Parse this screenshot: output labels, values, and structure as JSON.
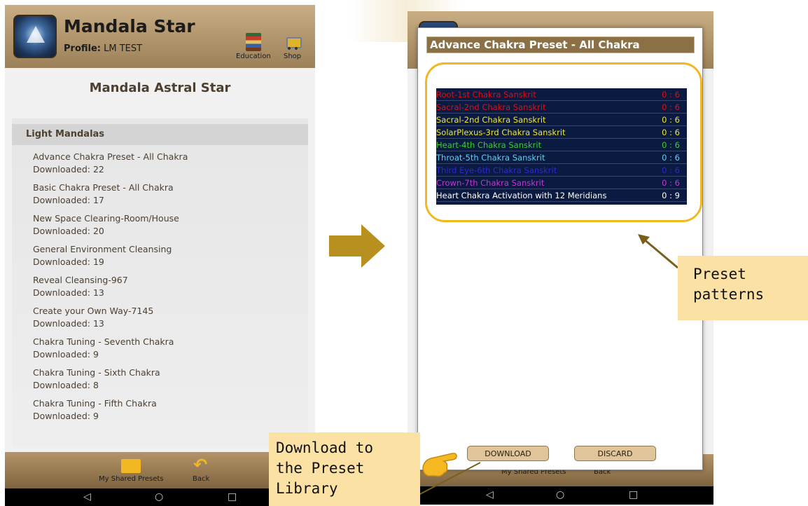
{
  "left": {
    "app_title": "Mandala Star",
    "profile_label": "Profile:",
    "profile_value": "LM TEST",
    "education_label": "Education",
    "shop_label": "Shop",
    "section_title": "Mandala Astral Star",
    "group_label": "Light Mandalas",
    "items": [
      {
        "name": "Advance Chakra Preset - All Chakra",
        "downloads": "Downloaded: 22"
      },
      {
        "name": "Basic Chakra Preset - All Chakra",
        "downloads": "Downloaded: 17"
      },
      {
        "name": "New Space Clearing-Room/House",
        "downloads": "Downloaded: 20"
      },
      {
        "name": "General Environment Cleansing",
        "downloads": "Downloaded: 19"
      },
      {
        "name": "Reveal Cleansing-967",
        "downloads": "Downloaded: 13"
      },
      {
        "name": "Create your Own Way-7145",
        "downloads": "Downloaded: 13"
      },
      {
        "name": "Chakra Tuning - Seventh Chakra",
        "downloads": "Downloaded: 9"
      },
      {
        "name": "Chakra Tuning - Sixth Chakra",
        "downloads": "Downloaded: 8"
      },
      {
        "name": "Chakra Tuning - Fifth Chakra",
        "downloads": "Downloaded: 9"
      }
    ],
    "footer_presets_label": "My Shared Presets",
    "footer_back_label": "Back"
  },
  "dialog": {
    "title": "Advance Chakra Preset - All Chakra",
    "rows": [
      {
        "name": "Root-1st Chakra Sanskrit",
        "value": "0 : 6",
        "color": "#e01010"
      },
      {
        "name": "Sacral-2nd Chakra Sanskrit",
        "value": "0 : 6",
        "color": "#e01010"
      },
      {
        "name": "Sacral-2nd Chakra Sanskrit",
        "value": "0 : 6",
        "color": "#f2e630"
      },
      {
        "name": "SolarPlexus-3rd Chakra Sanskrit",
        "value": "0 : 6",
        "color": "#f2e630"
      },
      {
        "name": "Heart-4th Chakra Sanskrit",
        "value": "0 : 6",
        "color": "#35d12e"
      },
      {
        "name": "Throat-5th Chakra Sanskrit",
        "value": "0 : 6",
        "color": "#5fd2f0"
      },
      {
        "name": "Third Eye-6th Chakra Sanskrit",
        "value": "0 : 6",
        "color": "#2a2ad8"
      },
      {
        "name": "Crown-7th Chakra Sanskrit",
        "value": "0 : 6",
        "color": "#c436d8"
      },
      {
        "name": "Heart Chakra Activation with 12 Meridians",
        "value": "0 : 9",
        "color": "#ffffff"
      }
    ],
    "download_label": "DOWNLOAD",
    "discard_label": "DISCARD"
  },
  "right_footer": {
    "presets_label": "My Shared Presets",
    "back_label": "Back"
  },
  "annotations": {
    "preset_callout": [
      "Preset",
      "patterns"
    ],
    "download_callout": [
      "Download to",
      "the Preset",
      "Library"
    ]
  },
  "colors": {
    "accent_gold": "#f2b824",
    "callout_bg": "#fbe2a4",
    "arrow": "#b8901f"
  }
}
